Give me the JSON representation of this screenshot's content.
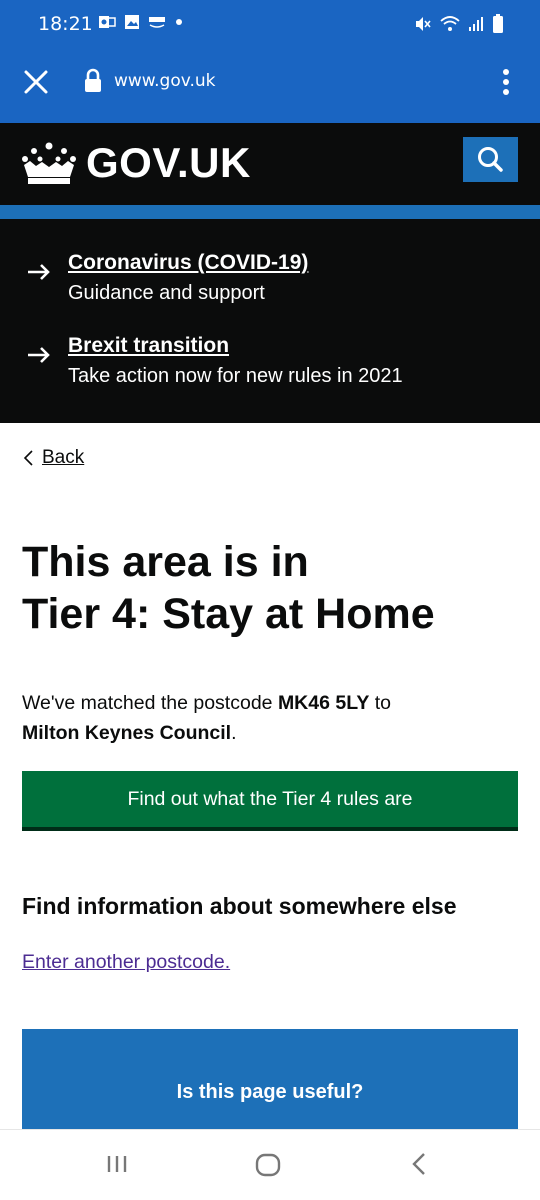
{
  "status_bar": {
    "time": "18:21",
    "left_icons": [
      "outlook-icon",
      "gallery-icon",
      "amazon-icon",
      "dot-icon"
    ],
    "right_icons": [
      "mute-icon",
      "wifi-icon",
      "signal-icon",
      "battery-icon"
    ]
  },
  "browser": {
    "url": "www.gov.uk"
  },
  "header": {
    "logo_text": "GOV.UK",
    "brand_color": "#0b0c0c",
    "accent_color": "#1d70b8"
  },
  "banners": [
    {
      "link": "Coronavirus (COVID-19)",
      "description": "Guidance and support"
    },
    {
      "link": "Brexit transition",
      "description": "Take action now for new rules in 2021"
    }
  ],
  "main": {
    "back_label": "Back",
    "title_line1": "This area is in",
    "title_line2": "Tier 4: Stay at Home",
    "match_prefix": "We've matched the postcode ",
    "postcode": "MK46 5LY",
    "match_middle": " to",
    "council": "Milton Keynes Council",
    "match_suffix": ".",
    "primary_button": "Find out what the Tier 4 rules are",
    "button_color": "#00703c",
    "section_heading": "Find information about somewhere else",
    "another_link": "Enter another postcode.",
    "feedback_question": "Is this page useful?"
  },
  "nav_bar": {
    "buttons": [
      "recent-apps-icon",
      "home-icon",
      "back-icon"
    ]
  }
}
